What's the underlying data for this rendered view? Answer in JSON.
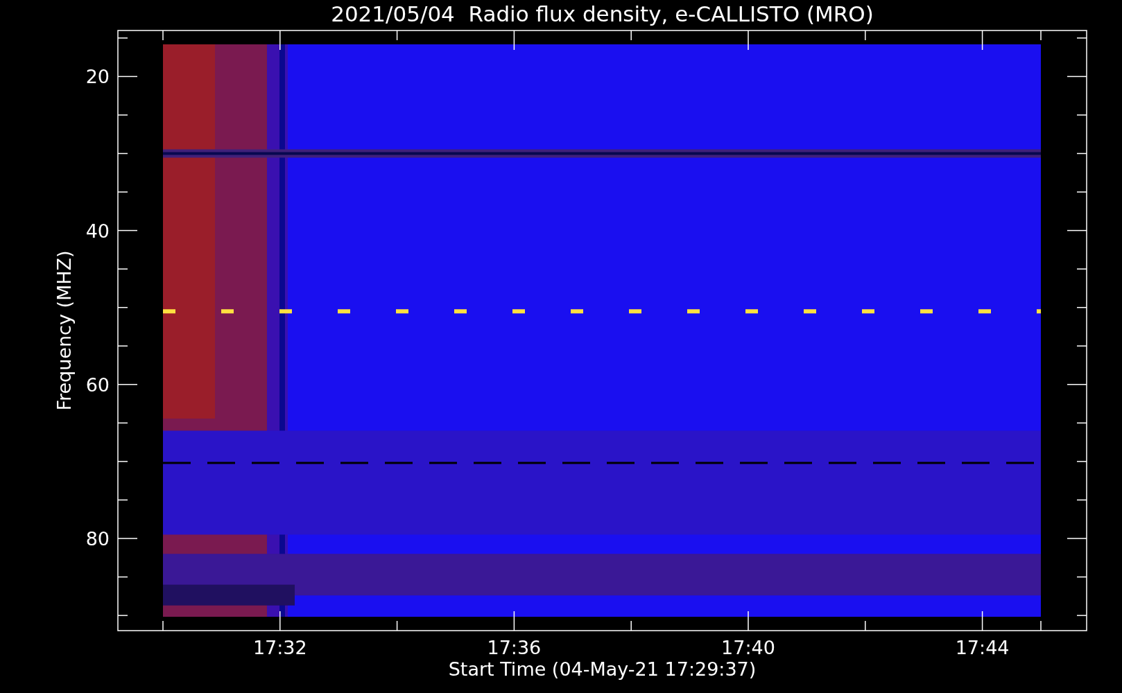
{
  "title": "2021/05/04  Radio flux density, e-CALLISTO (MRO)",
  "y_axis": {
    "label": "Frequency (MHZ)",
    "tick_labels": [
      "20",
      "40",
      "60",
      "80"
    ]
  },
  "x_axis": {
    "label": "Start Time (04-May-21 17:29:37)",
    "tick_labels": [
      "17:32",
      "17:36",
      "17:40",
      "17:44"
    ]
  }
}
